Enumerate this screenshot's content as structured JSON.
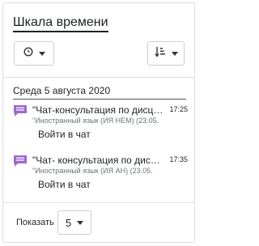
{
  "block": {
    "title": "Шкала времени"
  },
  "controls": {
    "filter_icon": "clock-icon",
    "sort_icon": "sort-by-time-icon"
  },
  "date_heading": "Среда 5 августа 2020",
  "events": [
    {
      "icon": "chat-icon",
      "name": "\"Чат-консультация по дисциплине",
      "course": "\"Иностранный язык (ИЯ НЕМ) (23.05.",
      "time": "17:25",
      "action": "Войти в чат"
    },
    {
      "icon": "chat-icon",
      "name": "\"Чат- консультация по дисциплине",
      "course": "\"Иностранный язык (ИЯ АН) (23.05.",
      "time": "17:35",
      "action": "Войти в чат"
    }
  ],
  "pagination": {
    "show_label": "Показать",
    "count": "5"
  },
  "colors": {
    "chat_icon": "#9b6ace",
    "text": "#1d2125",
    "muted": "#6a737b"
  }
}
